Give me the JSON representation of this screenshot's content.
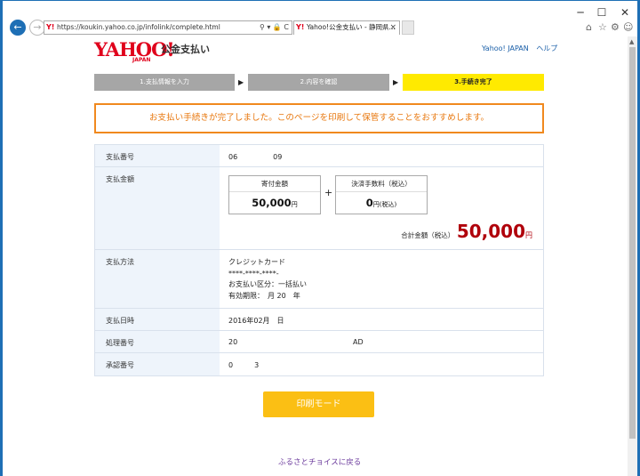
{
  "browser": {
    "url": "https://koukin.yahoo.co.jp/infolink/complete.html",
    "tab_title": "Yahoo!公金支払い - 静岡県...",
    "address_icons": "⚲ ▾ 🔒 C",
    "tab_close": "×",
    "back_icon": "back-arrow-icon",
    "window_min": "─",
    "window_max": "☐",
    "window_close": "✕",
    "toolbar_icons": [
      "home-icon",
      "star-icon",
      "gear-icon",
      "smiley-icon"
    ]
  },
  "header": {
    "logo": "YAHOO!",
    "logo_japan": "JAPAN",
    "service_name": "公金支払い",
    "links": [
      "Yahoo! JAPAN",
      "ヘルプ"
    ]
  },
  "steps": [
    {
      "label": "1.支払情報を入力",
      "state": "done"
    },
    {
      "label": "2.内容を確認",
      "state": "done"
    },
    {
      "label": "3.手続き完了",
      "state": "current"
    }
  ],
  "step_arrow": "▶",
  "notice": "お支払い手続きが完了しました。このページを印刷して保管することをおすすめします。",
  "details": {
    "payment_number": {
      "label": "支払番号",
      "value": "06　　　　　09"
    },
    "amount": {
      "label": "支払金額",
      "donation_label": "寄付金額",
      "donation_value": "50,000",
      "donation_unit": "円",
      "plus": "+",
      "fee_label": "決済手数料（税込）",
      "fee_value": "0",
      "fee_unit": "円(税込)",
      "total_label": "合計金額（税込）",
      "total_value": "50,000",
      "total_unit": "円"
    },
    "method": {
      "label": "支払方法",
      "line1": "クレジットカード",
      "line2": "****-****-****-",
      "line3": "お支払い区分：一括払い",
      "line4": "有効期限：　月 20　年"
    },
    "date": {
      "label": "支払日時",
      "value": "2016年02月　日"
    },
    "process": {
      "label": "処理番号",
      "value1": "20",
      "value2": "AD"
    },
    "approval": {
      "label": "承認番号",
      "value": "0　　　3"
    }
  },
  "print_button": "印刷モード",
  "back_link": "ふるさとチョイスに戻る",
  "colors": {
    "yahoo_red": "#e0001b",
    "step_current": "#ffea00",
    "step_done": "#a6a6a6",
    "notice_orange": "#f0891e",
    "total_red": "#b0000b",
    "print_button": "#fbbf14",
    "link_purple": "#6b3a9c"
  }
}
